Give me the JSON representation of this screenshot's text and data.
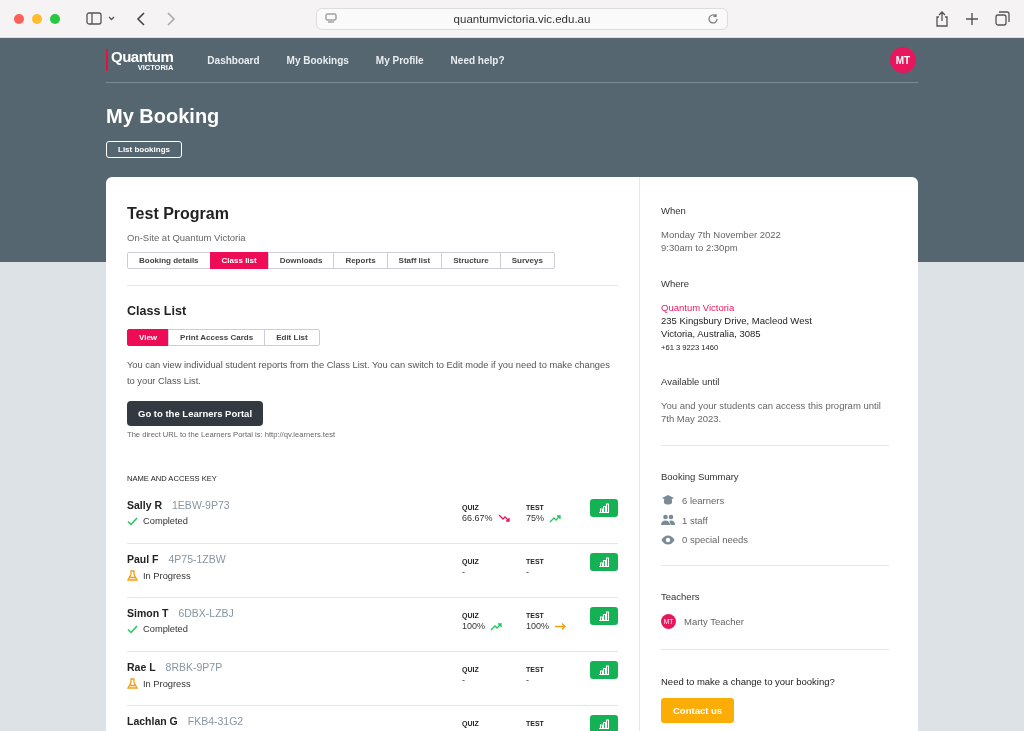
{
  "browser": {
    "url": "quantumvictoria.vic.edu.au"
  },
  "nav": {
    "logo_main": "Quantum",
    "logo_sub": "VICTORIA",
    "links": [
      "Dashboard",
      "My Bookings",
      "My Profile",
      "Need help?"
    ],
    "avatar": "MT"
  },
  "page": {
    "title": "My Booking",
    "back_button": "List bookings"
  },
  "program": {
    "title": "Test Program",
    "subtitle": "On-Site at Quantum Victoria",
    "tabs": [
      {
        "label": "Booking details",
        "selected": false
      },
      {
        "label": "Class list",
        "selected": true
      },
      {
        "label": "Downloads",
        "selected": false
      },
      {
        "label": "Reports",
        "selected": false
      },
      {
        "label": "Staff list",
        "selected": false
      },
      {
        "label": "Structure",
        "selected": false
      },
      {
        "label": "Surveys",
        "selected": false
      }
    ]
  },
  "class_list": {
    "title": "Class List",
    "modes": [
      {
        "label": "View",
        "selected": true
      },
      {
        "label": "Print Access Cards",
        "selected": false
      },
      {
        "label": "Edit List",
        "selected": false
      }
    ],
    "description": "You can view individual student reports from the Class List. You can switch to Edit mode if you need to make changes to your Class List.",
    "portal_button": "Go to the Learners Portal",
    "portal_note": "The direct URL to the Learners Portal is: http://qv.learners.test",
    "heading": "NAME AND ACCESS KEY",
    "students": [
      {
        "name": "Sally R",
        "key": "1EBW-9P73",
        "status": {
          "kind": "completed",
          "text": "Completed"
        },
        "scores": [
          {
            "label": "QUIZ",
            "value": "66.67%",
            "kind": "down"
          },
          {
            "label": "TEST",
            "value": "75%",
            "kind": "up"
          }
        ]
      },
      {
        "name": "Paul F",
        "key": "4P75-1ZBW",
        "status": {
          "kind": "in_progress",
          "text": "In Progress"
        },
        "scores": [
          {
            "label": "QUIZ",
            "value": "-"
          },
          {
            "label": "TEST",
            "value": "-"
          }
        ]
      },
      {
        "name": "Simon T",
        "key": "6DBX-LZBJ",
        "status": {
          "kind": "completed",
          "text": "Completed"
        },
        "scores": [
          {
            "label": "QUIZ",
            "value": "100%",
            "kind": "up"
          },
          {
            "label": "TEST",
            "value": "100%",
            "kind": "flat"
          }
        ]
      },
      {
        "name": "Rae L",
        "key": "8RBK-9P7P",
        "status": {
          "kind": "in_progress",
          "text": "In Progress"
        },
        "scores": [
          {
            "label": "QUIZ",
            "value": "-"
          },
          {
            "label": "TEST",
            "value": "-"
          }
        ]
      },
      {
        "name": "Lachlan G",
        "key": "FKB4-31G2",
        "scores": [
          {
            "label": "QUIZ"
          },
          {
            "label": "TEST"
          }
        ]
      }
    ]
  },
  "side": {
    "when_label": "When",
    "when_date": "Monday 7th November 2022",
    "when_time": "9:30am to 2:30pm",
    "where_label": "Where",
    "venue": "Quantum Victoria",
    "address1": "235 Kingsbury Drive, Macleod West",
    "address2": "Victoria, Australia, 3085",
    "phone": "+61 3 9223 1460",
    "until_label": "Available until",
    "until_text": "You and your students can access this program until 7th May 2023.",
    "summary_label": "Booking Summary",
    "summary": [
      {
        "kind": "learners",
        "text": "6 learners"
      },
      {
        "kind": "staff",
        "text": "1 staff"
      },
      {
        "kind": "special",
        "text": "0 special needs"
      }
    ],
    "teachers_label": "Teachers",
    "teachers": [
      {
        "initials": "MT",
        "name": "Marty Teacher"
      }
    ],
    "change_text": "Need to make a change to your booking?",
    "contact_button": "Contact us"
  }
}
